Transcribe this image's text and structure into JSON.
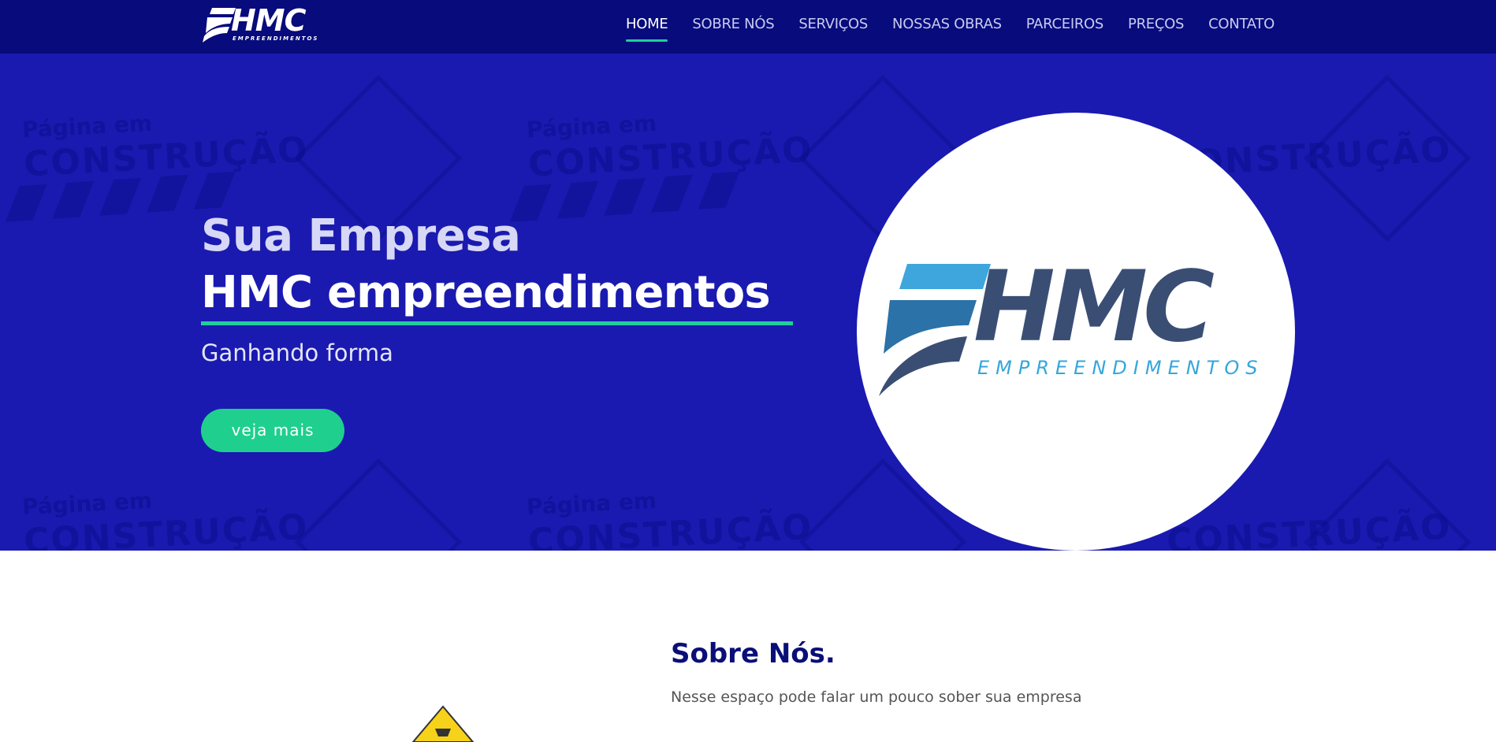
{
  "brand": {
    "logo_text": "HMC",
    "logo_subtext": "EMPREENDIMENTOS",
    "icon": "hmc-logo-icon"
  },
  "nav": {
    "items": [
      {
        "label": "HOME",
        "active": true
      },
      {
        "label": "SOBRE NÓS",
        "active": false
      },
      {
        "label": "SERVIÇOS",
        "active": false
      },
      {
        "label": "NOSSAS OBRAS",
        "active": false
      },
      {
        "label": "PARCEIROS",
        "active": false
      },
      {
        "label": "PREÇOS",
        "active": false
      },
      {
        "label": "CONTATO",
        "active": false
      }
    ]
  },
  "hero": {
    "title_line1": "Sua Empresa",
    "title_line2": "HMC empreendimentos",
    "subtitle": "Ganhando forma",
    "cta_label": "veja mais",
    "watermark_small": "Página em",
    "watermark_big": "CONSTRUÇÃO",
    "logo_text": "HMC",
    "logo_subtext": "EMPREENDIMENTOS"
  },
  "about": {
    "title": "Sobre Nós.",
    "text": "Nesse espaço pode falar um pouco sober sua empresa"
  },
  "colors": {
    "nav_bg": "#070b7c",
    "hero_bg": "#1a1ab0",
    "accent": "#1fcf9a",
    "about_title": "#0a0f78",
    "logo_dark": "#3a4e74",
    "logo_light": "#35a6dc"
  }
}
